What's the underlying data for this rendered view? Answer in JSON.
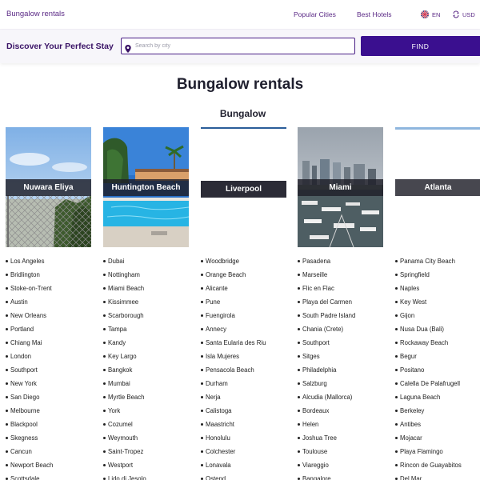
{
  "nav": {
    "brand": "Bungalow rentals",
    "popular_cities": "Popular Cities",
    "best_hotels": "Best Hotels",
    "language": "EN",
    "currency": "USD"
  },
  "search": {
    "heading": "Discover Your Perfect Stay",
    "placeholder": "Search by city",
    "button": "FIND"
  },
  "page_title": "Bungalow rentals",
  "section_title": "Bungalow",
  "cards": [
    {
      "name": "Nuwara Eliya"
    },
    {
      "name": "Huntington Beach"
    },
    {
      "name": "Liverpool"
    },
    {
      "name": "Miami"
    },
    {
      "name": "Atlanta"
    }
  ],
  "columns": [
    [
      "Los Angeles",
      "Bridlington",
      "Stoke-on-Trent",
      "Austin",
      "New Orleans",
      "Portland",
      "Chiang Mai",
      "London",
      "Southport",
      "New York",
      "San Diego",
      "Melbourne",
      "Blackpool",
      "Skegness",
      "Cancun",
      "Newport Beach",
      "Scottsdale"
    ],
    [
      "Dubai",
      "Nottingham",
      "Miami Beach",
      "Kissimmee",
      "Scarborough",
      "Tampa",
      "Kandy",
      "Key Largo",
      "Bangkok",
      "Mumbai",
      "Myrtle Beach",
      "York",
      "Cozumel",
      "Weymouth",
      "Saint-Tropez",
      "Westport",
      "Lido di Jesolo"
    ],
    [
      "Woodbridge",
      "Orange Beach",
      "Alicante",
      "Pune",
      "Fuengirola",
      "Annecy",
      "Santa Eularia des Riu",
      "Isla Mujeres",
      "Pensacola Beach",
      "Durham",
      "Nerja",
      "Calistoga",
      "Maastricht",
      "Honolulu",
      "Colchester",
      "Lonavala",
      "Ostend"
    ],
    [
      "Pasadena",
      "Marseille",
      "Flic en Flac",
      "Playa del Carmen",
      "South Padre Island",
      "Chania (Crete)",
      "Southport",
      "Sitges",
      "Philadelphia",
      "Salzburg",
      "Alcudia (Mallorca)",
      "Bordeaux",
      "Helen",
      "Joshua Tree",
      "Toulouse",
      "Viareggio",
      "Bangalore"
    ],
    [
      "Panama City Beach",
      "Springfield",
      "Naples",
      "Key West",
      "Gijon",
      "Nusa Dua (Bali)",
      "Rockaway Beach",
      "Begur",
      "Positano",
      "Calella De Palafrugell",
      "Laguna Beach",
      "Berkeley",
      "Antibes",
      "Mojacar",
      "Playa Flamingo",
      "Rincon de Guayabitos",
      "Del Mar"
    ]
  ]
}
